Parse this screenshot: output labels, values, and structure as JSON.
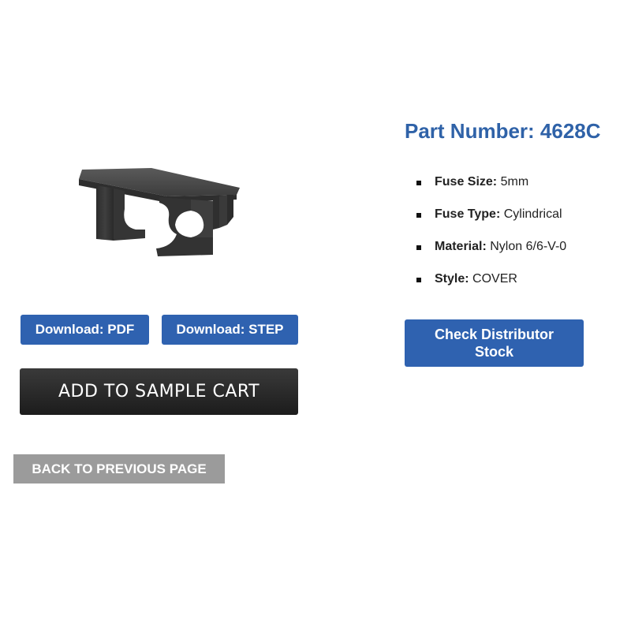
{
  "product": {
    "title": "Part Number: 4628C",
    "image": "black nylon fuse cover part"
  },
  "specs": [
    {
      "key": "Fuse Size:",
      "value": "5mm"
    },
    {
      "key": "Fuse Type:",
      "value": "Cylindrical"
    },
    {
      "key": "Material:",
      "value": "Nylon 6/6-V-0"
    },
    {
      "key": "Style:",
      "value": "COVER"
    }
  ],
  "buttons": {
    "download_pdf": "Download: PDF",
    "download_step": "Download: STEP",
    "add_to_cart": "ADD TO SAMPLE CART",
    "back": "BACK TO PREVIOUS PAGE",
    "check_distributor": "Check Distributor Stock"
  },
  "colors": {
    "accent_blue": "#2f62b0",
    "title_blue": "#2f62a8",
    "cart_dark": "#262626",
    "back_gray": "#9b9b9b"
  }
}
